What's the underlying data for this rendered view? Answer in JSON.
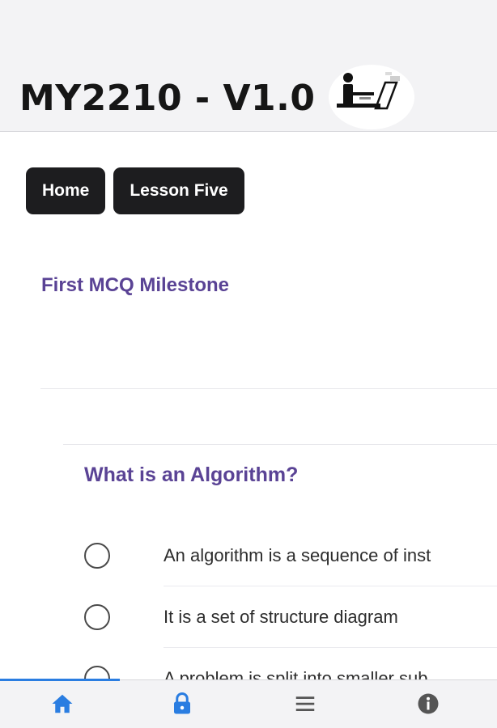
{
  "header": {
    "title": "MY2210 - V1.0",
    "logo_icon": "person-at-laptop-icon"
  },
  "breadcrumbs": [
    {
      "label": "Home"
    },
    {
      "label": "Lesson Five"
    }
  ],
  "milestone": {
    "title": "First MCQ Milestone"
  },
  "question": {
    "title": "What is an Algorithm?",
    "options": [
      {
        "label": "An algorithm is a sequence of inst",
        "selected": false
      },
      {
        "label": "It is a set of structure diagram",
        "selected": false
      },
      {
        "label": "A problem is split into smaller sub",
        "selected": false
      }
    ]
  },
  "tabbar": {
    "active": "home",
    "tabs": [
      {
        "icon": "home-icon",
        "color": "#2a7de1"
      },
      {
        "icon": "lock-icon",
        "color": "#2a7de1"
      },
      {
        "icon": "menu-icon",
        "color": "#555555"
      },
      {
        "icon": "info-icon",
        "color": "#555555"
      }
    ]
  },
  "colors": {
    "accent": "#5a4395",
    "button_bg": "#1d1d1f",
    "tab_active": "#2a7de1"
  }
}
